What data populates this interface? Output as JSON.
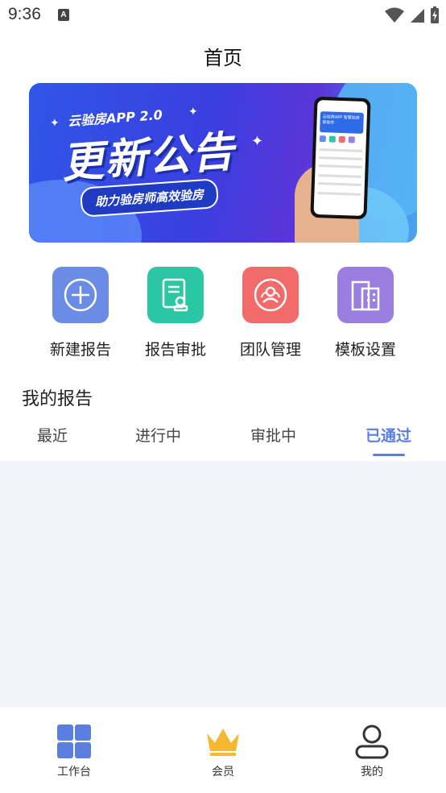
{
  "status_bar": {
    "time": "9:36",
    "notification_glyph": "A",
    "icons": [
      "wifi-icon",
      "signal-icon",
      "battery-charging-icon"
    ]
  },
  "header": {
    "title": "首页"
  },
  "banner": {
    "subtitle": "云验房APP 2.0",
    "headline": "更新公告",
    "tagline": "助力验房师高效验房",
    "phone_card_text": "云验房APP 智慧验房新软件"
  },
  "quick_actions": [
    {
      "label": "新建报告",
      "icon": "plus-circle-icon",
      "color": "#6a8be6"
    },
    {
      "label": "报告审批",
      "icon": "document-stamp-icon",
      "color": "#2bc7a4"
    },
    {
      "label": "团队管理",
      "icon": "team-icon",
      "color": "#f26b6b"
    },
    {
      "label": "模板设置",
      "icon": "building-icon",
      "color": "#9b7fe0"
    }
  ],
  "reports": {
    "title": "我的报告",
    "tabs": [
      "最近",
      "进行中",
      "审批中",
      "已通过"
    ],
    "active_tab": "已通过"
  },
  "bottom_nav": [
    {
      "label": "工作台",
      "icon": "grid-icon",
      "color": "#5b7fe0"
    },
    {
      "label": "会员",
      "icon": "crown-icon",
      "color": "#f5b82e"
    },
    {
      "label": "我的",
      "icon": "user-icon",
      "color": "#333333"
    }
  ],
  "colors": {
    "accent": "#5b7fe0",
    "list_bg": "#f3f4f8"
  }
}
